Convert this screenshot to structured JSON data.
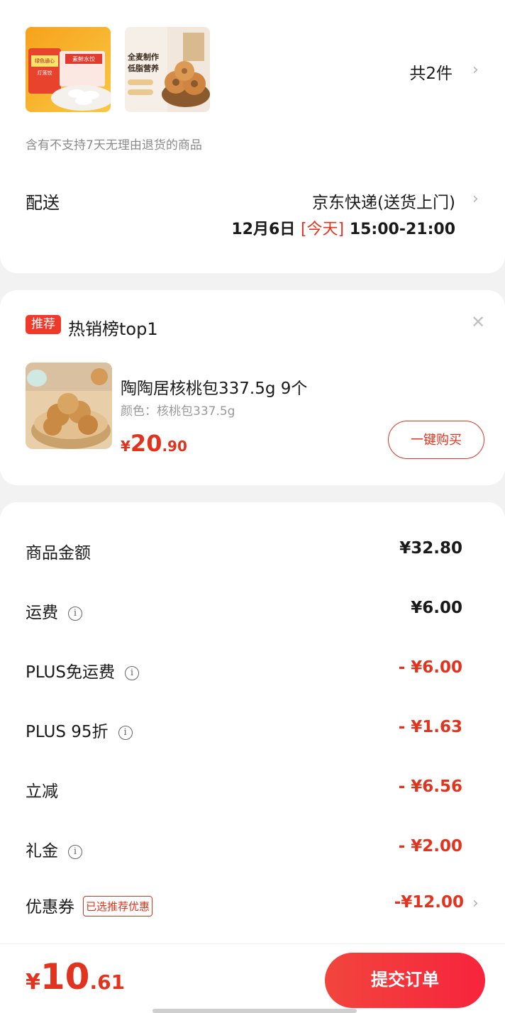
{
  "order": {
    "item_count": "共2件",
    "return_notice": "含有不支持7天无理由退货的商品",
    "shipping_label": "配送",
    "shipping_method": "京东快递(送货上门)",
    "shipping_date": "12月6日",
    "shipping_today": "[今天]",
    "shipping_window": "15:00-21:00",
    "product1_texts": [
      "绿色通心",
      "灯笼饺",
      "素鲜水饺"
    ],
    "product2_texts": [
      "全麦制作",
      "低脂营养"
    ]
  },
  "recommend": {
    "badge": "推荐",
    "title": "热销榜top1",
    "product_name": "陶陶居核桃包337.5g 9个",
    "product_spec": "颜色：核桃包337.5g",
    "price_currency": "¥",
    "price_int": "20",
    "price_dec": ".90",
    "buy_label": "一键购买"
  },
  "price_details": [
    {
      "label": "商品金额",
      "value": "¥32.80",
      "info": false
    },
    {
      "label": "运费",
      "value": "¥6.00",
      "info": true
    },
    {
      "label": "PLUS免运费",
      "value": "- ¥6.00",
      "info": true
    },
    {
      "label": "PLUS 95折",
      "value": "- ¥1.63",
      "info": true
    },
    {
      "label": "立减",
      "value": "- ¥6.56",
      "info": false
    },
    {
      "label": "礼金",
      "value": "- ¥2.00",
      "info": true
    },
    {
      "label": "优惠券",
      "value": "-¥12.00",
      "tag": "已选推荐优惠"
    }
  ],
  "bottom": {
    "total_currency": "¥",
    "total_int": "10",
    "total_dec": ".61",
    "submit_label": "提交订单"
  },
  "colors": {
    "accent": "#e2331e",
    "background": "#f2f2f2"
  }
}
